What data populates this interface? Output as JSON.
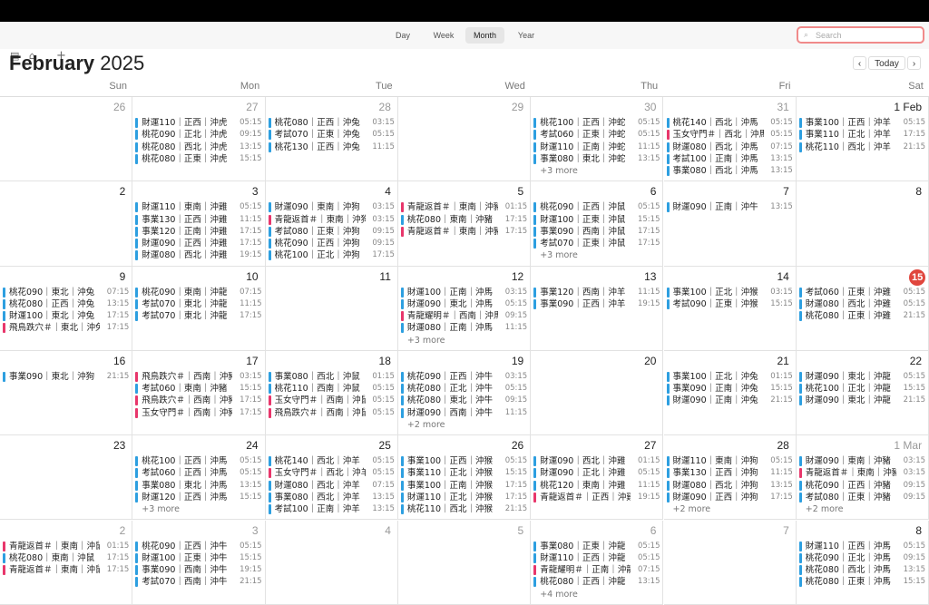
{
  "toolbar": {
    "views": [
      "Day",
      "Week",
      "Month",
      "Year"
    ],
    "selected_view": "Month",
    "search_placeholder": "Search",
    "today_label": "Today",
    "prev_icon": "‹",
    "next_icon": "›",
    "icons": [
      "calendar-icon",
      "inbox-icon",
      "add-icon"
    ]
  },
  "header": {
    "month": "February",
    "year": "2025"
  },
  "weekdays": [
    "Sun",
    "Mon",
    "Tue",
    "Wed",
    "Thu",
    "Fri",
    "Sat"
  ],
  "colors": {
    "blue": "#2d9fe0",
    "red": "#e8366b",
    "today": "#e0463d"
  },
  "weeks": [
    [
      {
        "day": "26",
        "dim": true,
        "events": []
      },
      {
        "day": "27",
        "dim": true,
        "events": [
          {
            "t": "財運110｜正西｜沖虎",
            "tm": "05:15",
            "c": "blue"
          },
          {
            "t": "桃花090｜正北｜沖虎",
            "tm": "09:15",
            "c": "blue"
          },
          {
            "t": "桃花080｜西北｜沖虎",
            "tm": "13:15",
            "c": "blue"
          },
          {
            "t": "桃花080｜正東｜沖虎",
            "tm": "15:15",
            "c": "blue"
          }
        ]
      },
      {
        "day": "28",
        "dim": true,
        "events": [
          {
            "t": "桃花080｜正西｜沖兔",
            "tm": "03:15",
            "c": "blue"
          },
          {
            "t": "考試070｜正東｜沖兔",
            "tm": "05:15",
            "c": "blue"
          },
          {
            "t": "桃花130｜正西｜沖兔",
            "tm": "11:15",
            "c": "blue"
          }
        ]
      },
      {
        "day": "29",
        "dim": true,
        "events": []
      },
      {
        "day": "30",
        "dim": true,
        "events": [
          {
            "t": "桃花100｜正西｜沖蛇",
            "tm": "05:15",
            "c": "blue"
          },
          {
            "t": "考試060｜正東｜沖蛇",
            "tm": "05:15",
            "c": "blue"
          },
          {
            "t": "財運110｜正南｜沖蛇",
            "tm": "11:15",
            "c": "blue"
          },
          {
            "t": "事業080｜東北｜沖蛇",
            "tm": "13:15",
            "c": "blue"
          }
        ],
        "more": "+3 more"
      },
      {
        "day": "31",
        "dim": true,
        "events": [
          {
            "t": "桃花140｜西北｜沖馬",
            "tm": "05:15",
            "c": "blue"
          },
          {
            "t": "玉女守門＃｜西北｜沖馬",
            "tm": "05:15",
            "c": "red"
          },
          {
            "t": "財運080｜西北｜沖馬",
            "tm": "07:15",
            "c": "blue"
          },
          {
            "t": "考試100｜正南｜沖馬",
            "tm": "13:15",
            "c": "blue"
          },
          {
            "t": "事業080｜西北｜沖馬",
            "tm": "13:15",
            "c": "blue"
          }
        ]
      },
      {
        "day": "1 Feb",
        "dim": false,
        "events": [
          {
            "t": "事業100｜正西｜沖羊",
            "tm": "05:15",
            "c": "blue"
          },
          {
            "t": "事業110｜正北｜沖羊",
            "tm": "17:15",
            "c": "blue"
          },
          {
            "t": "桃花110｜西北｜沖羊",
            "tm": "21:15",
            "c": "blue"
          }
        ]
      }
    ],
    [
      {
        "day": "2",
        "dim": false,
        "events": []
      },
      {
        "day": "3",
        "dim": false,
        "events": [
          {
            "t": "財運110｜東南｜沖雞",
            "tm": "05:15",
            "c": "blue"
          },
          {
            "t": "事業130｜正西｜沖雞",
            "tm": "11:15",
            "c": "blue"
          },
          {
            "t": "事業120｜正南｜沖雞",
            "tm": "17:15",
            "c": "blue"
          },
          {
            "t": "財運090｜正西｜沖雞",
            "tm": "17:15",
            "c": "blue"
          },
          {
            "t": "財運080｜西北｜沖雞",
            "tm": "19:15",
            "c": "blue"
          }
        ]
      },
      {
        "day": "4",
        "dim": false,
        "events": [
          {
            "t": "財運090｜東南｜沖狗",
            "tm": "03:15",
            "c": "blue"
          },
          {
            "t": "青龍返首＃｜東南｜沖狗",
            "tm": "03:15",
            "c": "red"
          },
          {
            "t": "考試080｜正東｜沖狗",
            "tm": "09:15",
            "c": "blue"
          },
          {
            "t": "桃花090｜正西｜沖狗",
            "tm": "09:15",
            "c": "blue"
          },
          {
            "t": "桃花100｜正北｜沖狗",
            "tm": "17:15",
            "c": "blue"
          }
        ]
      },
      {
        "day": "5",
        "dim": false,
        "events": [
          {
            "t": "青龍返首＃｜東南｜沖豬",
            "tm": "01:15",
            "c": "red"
          },
          {
            "t": "桃花080｜東南｜沖豬",
            "tm": "17:15",
            "c": "blue"
          },
          {
            "t": "青龍返首＃｜東南｜沖豬",
            "tm": "17:15",
            "c": "red"
          }
        ]
      },
      {
        "day": "6",
        "dim": false,
        "events": [
          {
            "t": "桃花090｜正西｜沖鼠",
            "tm": "05:15",
            "c": "blue"
          },
          {
            "t": "財運100｜正東｜沖鼠",
            "tm": "15:15",
            "c": "blue"
          },
          {
            "t": "事業090｜西南｜沖鼠",
            "tm": "17:15",
            "c": "blue"
          },
          {
            "t": "考試070｜正東｜沖鼠",
            "tm": "17:15",
            "c": "blue"
          }
        ],
        "more": "+3 more"
      },
      {
        "day": "7",
        "dim": false,
        "events": [
          {
            "t": "財運090｜正南｜沖牛",
            "tm": "13:15",
            "c": "blue"
          }
        ]
      },
      {
        "day": "8",
        "dim": false,
        "events": []
      }
    ],
    [
      {
        "day": "9",
        "dim": false,
        "events": [
          {
            "t": "桃花090｜東北｜沖兔",
            "tm": "07:15",
            "c": "blue"
          },
          {
            "t": "桃花080｜正西｜沖兔",
            "tm": "13:15",
            "c": "blue"
          },
          {
            "t": "財運100｜東北｜沖兔",
            "tm": "17:15",
            "c": "blue"
          },
          {
            "t": "飛鳥跌穴＃｜東北｜沖兔",
            "tm": "17:15",
            "c": "red"
          }
        ]
      },
      {
        "day": "10",
        "dim": false,
        "events": [
          {
            "t": "桃花090｜東南｜沖龍",
            "tm": "07:15",
            "c": "blue"
          },
          {
            "t": "考試070｜東北｜沖龍",
            "tm": "11:15",
            "c": "blue"
          },
          {
            "t": "考試070｜東北｜沖龍",
            "tm": "17:15",
            "c": "blue"
          }
        ]
      },
      {
        "day": "11",
        "dim": false,
        "events": []
      },
      {
        "day": "12",
        "dim": false,
        "events": [
          {
            "t": "財運100｜正南｜沖馬",
            "tm": "03:15",
            "c": "blue"
          },
          {
            "t": "財運090｜東北｜沖馬",
            "tm": "05:15",
            "c": "blue"
          },
          {
            "t": "青龍耀明＃｜西南｜沖馬",
            "tm": "09:15",
            "c": "red"
          },
          {
            "t": "財運080｜正南｜沖馬",
            "tm": "11:15",
            "c": "blue"
          }
        ],
        "more": "+3 more"
      },
      {
        "day": "13",
        "dim": false,
        "events": [
          {
            "t": "事業120｜西南｜沖羊",
            "tm": "11:15",
            "c": "blue"
          },
          {
            "t": "事業090｜正西｜沖羊",
            "tm": "19:15",
            "c": "blue"
          }
        ]
      },
      {
        "day": "14",
        "dim": false,
        "events": [
          {
            "t": "事業100｜正北｜沖猴",
            "tm": "03:15",
            "c": "blue"
          },
          {
            "t": "考試090｜正東｜沖猴",
            "tm": "15:15",
            "c": "blue"
          }
        ]
      },
      {
        "day": "15",
        "dim": false,
        "today": true,
        "events": [
          {
            "t": "考試060｜正東｜沖雞",
            "tm": "05:15",
            "c": "blue"
          },
          {
            "t": "財運080｜西北｜沖雞",
            "tm": "05:15",
            "c": "blue"
          },
          {
            "t": "桃花080｜正東｜沖雞",
            "tm": "21:15",
            "c": "blue"
          }
        ]
      }
    ],
    [
      {
        "day": "16",
        "dim": false,
        "events": [
          {
            "t": "事業090｜東北｜沖狗",
            "tm": "21:15",
            "c": "blue"
          }
        ]
      },
      {
        "day": "17",
        "dim": false,
        "events": [
          {
            "t": "飛鳥跌穴＃｜西南｜沖豬",
            "tm": "03:15",
            "c": "red"
          },
          {
            "t": "考試060｜東南｜沖豬",
            "tm": "15:15",
            "c": "blue"
          },
          {
            "t": "飛鳥跌穴＃｜西南｜沖豬",
            "tm": "17:15",
            "c": "red"
          },
          {
            "t": "玉女守門＃｜西南｜沖豬",
            "tm": "17:15",
            "c": "red"
          }
        ]
      },
      {
        "day": "18",
        "dim": false,
        "events": [
          {
            "t": "事業080｜西北｜沖鼠",
            "tm": "01:15",
            "c": "blue"
          },
          {
            "t": "桃花110｜西南｜沖鼠",
            "tm": "05:15",
            "c": "blue"
          },
          {
            "t": "玉女守門＃｜西南｜沖鼠",
            "tm": "05:15",
            "c": "red"
          },
          {
            "t": "飛鳥跌穴＃｜西南｜沖鼠",
            "tm": "05:15",
            "c": "red"
          }
        ]
      },
      {
        "day": "19",
        "dim": false,
        "events": [
          {
            "t": "桃花090｜正西｜沖牛",
            "tm": "03:15",
            "c": "blue"
          },
          {
            "t": "桃花080｜正北｜沖牛",
            "tm": "05:15",
            "c": "blue"
          },
          {
            "t": "桃花080｜東北｜沖牛",
            "tm": "09:15",
            "c": "blue"
          },
          {
            "t": "財運090｜西南｜沖牛",
            "tm": "11:15",
            "c": "blue"
          }
        ],
        "more": "+2 more"
      },
      {
        "day": "20",
        "dim": false,
        "events": []
      },
      {
        "day": "21",
        "dim": false,
        "events": [
          {
            "t": "事業100｜正北｜沖兔",
            "tm": "01:15",
            "c": "blue"
          },
          {
            "t": "事業090｜正南｜沖兔",
            "tm": "15:15",
            "c": "blue"
          },
          {
            "t": "財運090｜正南｜沖兔",
            "tm": "21:15",
            "c": "blue"
          }
        ]
      },
      {
        "day": "22",
        "dim": false,
        "events": [
          {
            "t": "財運090｜東北｜沖龍",
            "tm": "05:15",
            "c": "blue"
          },
          {
            "t": "桃花100｜正北｜沖龍",
            "tm": "15:15",
            "c": "blue"
          },
          {
            "t": "財運090｜東北｜沖龍",
            "tm": "21:15",
            "c": "blue"
          }
        ]
      }
    ],
    [
      {
        "day": "23",
        "dim": false,
        "events": []
      },
      {
        "day": "24",
        "dim": false,
        "events": [
          {
            "t": "桃花100｜正西｜沖馬",
            "tm": "05:15",
            "c": "blue"
          },
          {
            "t": "考試060｜正西｜沖馬",
            "tm": "05:15",
            "c": "blue"
          },
          {
            "t": "事業080｜東北｜沖馬",
            "tm": "13:15",
            "c": "blue"
          },
          {
            "t": "財運120｜正西｜沖馬",
            "tm": "15:15",
            "c": "blue"
          }
        ],
        "more": "+3 more"
      },
      {
        "day": "25",
        "dim": false,
        "events": [
          {
            "t": "桃花140｜西北｜沖羊",
            "tm": "05:15",
            "c": "blue"
          },
          {
            "t": "玉女守門＃｜西北｜沖羊",
            "tm": "05:15",
            "c": "red"
          },
          {
            "t": "財運080｜西北｜沖羊",
            "tm": "07:15",
            "c": "blue"
          },
          {
            "t": "事業080｜西北｜沖羊",
            "tm": "13:15",
            "c": "blue"
          },
          {
            "t": "考試100｜正南｜沖羊",
            "tm": "13:15",
            "c": "blue"
          }
        ]
      },
      {
        "day": "26",
        "dim": false,
        "events": [
          {
            "t": "事業100｜正西｜沖猴",
            "tm": "05:15",
            "c": "blue"
          },
          {
            "t": "事業110｜正北｜沖猴",
            "tm": "15:15",
            "c": "blue"
          },
          {
            "t": "事業100｜正南｜沖猴",
            "tm": "17:15",
            "c": "blue"
          },
          {
            "t": "財運110｜正北｜沖猴",
            "tm": "17:15",
            "c": "blue"
          },
          {
            "t": "桃花110｜西北｜沖猴",
            "tm": "21:15",
            "c": "blue"
          }
        ]
      },
      {
        "day": "27",
        "dim": false,
        "events": [
          {
            "t": "財運090｜西北｜沖雞",
            "tm": "01:15",
            "c": "blue"
          },
          {
            "t": "財運090｜正北｜沖雞",
            "tm": "05:15",
            "c": "blue"
          },
          {
            "t": "桃花120｜東南｜沖雞",
            "tm": "11:15",
            "c": "blue"
          },
          {
            "t": "青龍返首＃｜正西｜沖雞",
            "tm": "19:15",
            "c": "red"
          }
        ]
      },
      {
        "day": "28",
        "dim": false,
        "events": [
          {
            "t": "財運110｜東南｜沖狗",
            "tm": "05:15",
            "c": "blue"
          },
          {
            "t": "事業130｜正西｜沖狗",
            "tm": "11:15",
            "c": "blue"
          },
          {
            "t": "財運080｜西北｜沖狗",
            "tm": "13:15",
            "c": "blue"
          },
          {
            "t": "財運090｜正西｜沖狗",
            "tm": "17:15",
            "c": "blue"
          }
        ],
        "more": "+2 more"
      },
      {
        "day": "1 Mar",
        "dim": true,
        "events": [
          {
            "t": "財運090｜東南｜沖豬",
            "tm": "03:15",
            "c": "blue"
          },
          {
            "t": "青龍返首＃｜東南｜沖豬",
            "tm": "03:15",
            "c": "red"
          },
          {
            "t": "桃花090｜正西｜沖豬",
            "tm": "09:15",
            "c": "blue"
          },
          {
            "t": "考試080｜正東｜沖豬",
            "tm": "09:15",
            "c": "blue"
          }
        ],
        "more": "+2 more"
      }
    ],
    [
      {
        "day": "2",
        "dim": true,
        "events": [
          {
            "t": "青龍返首＃｜東南｜沖鼠",
            "tm": "01:15",
            "c": "red"
          },
          {
            "t": "桃花080｜東南｜沖鼠",
            "tm": "17:15",
            "c": "blue"
          },
          {
            "t": "青龍返首＃｜東南｜沖鼠",
            "tm": "17:15",
            "c": "red"
          }
        ]
      },
      {
        "day": "3",
        "dim": true,
        "events": [
          {
            "t": "桃花090｜正西｜沖牛",
            "tm": "05:15",
            "c": "blue"
          },
          {
            "t": "財運100｜正東｜沖牛",
            "tm": "15:15",
            "c": "blue"
          },
          {
            "t": "事業090｜西南｜沖牛",
            "tm": "19:15",
            "c": "blue"
          },
          {
            "t": "考試070｜西南｜沖牛",
            "tm": "21:15",
            "c": "blue"
          }
        ]
      },
      {
        "day": "4",
        "dim": true,
        "events": []
      },
      {
        "day": "5",
        "dim": true,
        "events": []
      },
      {
        "day": "6",
        "dim": true,
        "events": [
          {
            "t": "事業080｜正東｜沖龍",
            "tm": "05:15",
            "c": "blue"
          },
          {
            "t": "財運110｜正西｜沖龍",
            "tm": "05:15",
            "c": "blue"
          },
          {
            "t": "青龍耀明＃｜正南｜沖龍",
            "tm": "07:15",
            "c": "red"
          },
          {
            "t": "桃花080｜正西｜沖龍",
            "tm": "13:15",
            "c": "blue"
          }
        ],
        "more": "+4 more"
      },
      {
        "day": "7",
        "dim": true,
        "events": []
      },
      {
        "day": "8",
        "dim": false,
        "events": [
          {
            "t": "財運110｜正西｜沖馬",
            "tm": "05:15",
            "c": "blue"
          },
          {
            "t": "桃花090｜正北｜沖馬",
            "tm": "09:15",
            "c": "blue"
          },
          {
            "t": "桃花080｜西北｜沖馬",
            "tm": "13:15",
            "c": "blue"
          },
          {
            "t": "桃花080｜正東｜沖馬",
            "tm": "15:15",
            "c": "blue"
          }
        ]
      }
    ]
  ]
}
